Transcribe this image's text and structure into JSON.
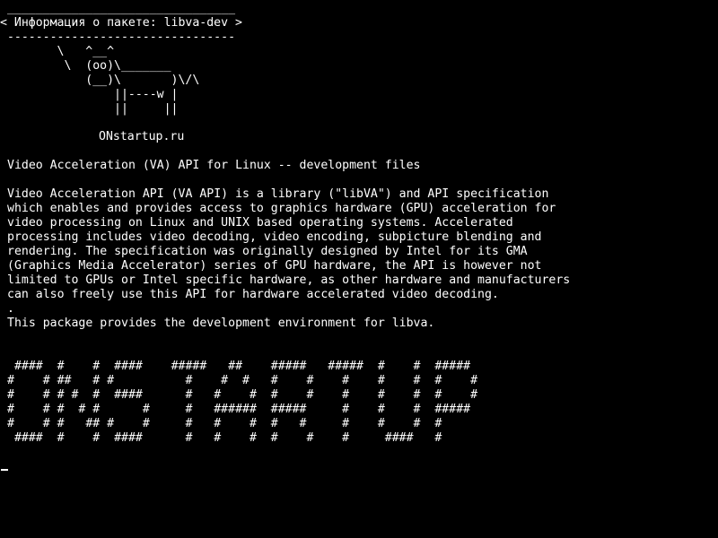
{
  "header": {
    "box": " ________________________________\n< Информация о пакете: libva-dev >\n --------------------------------\n        \\   ^__^\n         \\  (oo)\\_______\n            (__)\\       )\\/\\\n                ||----w |\n                ||     ||"
  },
  "brand": "ONstartup.ru",
  "package": {
    "summary": "Video Acceleration (VA) API for Linux -- development files",
    "description": "Video Acceleration API (VA API) is a library (\"libVA\") and API specification\nwhich enables and provides access to graphics hardware (GPU) acceleration for\nvideo processing on Linux and UNIX based operating systems. Accelerated\nprocessing includes video decoding, video encoding, subpicture blending and\nrendering. The specification was originally designed by Intel for its GMA\n(Graphics Media Accelerator) series of GPU hardware, the API is however not\nlimited to GPUs or Intel specific hardware, as other hardware and manufacturers\ncan also freely use this API for hardware accelerated video decoding.",
    "separator": ".",
    "provides": "This package provides the development environment for libva."
  },
  "banner": {
    "text": " ####  #    #  ####    #####   ##    #####   #####  #    #  #####\n#    # ##   # #          #    #  #   #    #    #    #    #  #    #\n#    # # #  #  ####      #   #    #  #    #    #    #    #  #    #\n#    # #  # #      #     #   ######  #####     #    #    #  #####\n#    # #   ## #    #     #   #    #  #   #     #    #    #  #\n ####  #    #  ####      #   #    #  #    #    #     ####   #"
  },
  "colors": {
    "background": "#000000",
    "foreground": "#ffffff"
  }
}
